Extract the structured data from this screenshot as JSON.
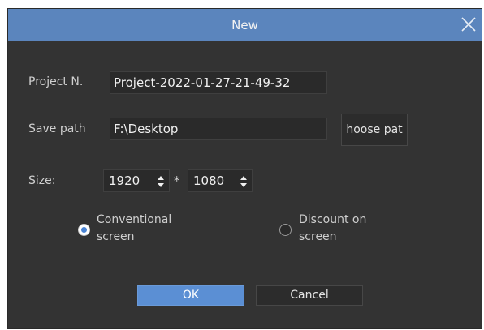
{
  "dialog": {
    "title": "New",
    "close_icon": "close-icon"
  },
  "form": {
    "project_name_label": "Project N.",
    "project_name_value": "Project-2022-01-27-21-49-32",
    "save_path_label": "Save path",
    "save_path_value": "F:\\Desktop",
    "choose_path_button": "hoose pat",
    "size_label": "Size:",
    "width_value": "1920",
    "separator": "*",
    "height_value": "1080"
  },
  "screen_mode": {
    "options": [
      {
        "label": "Conventional screen",
        "checked": true
      },
      {
        "label": "Discount on screen",
        "checked": false
      }
    ]
  },
  "buttons": {
    "ok": "OK",
    "cancel": "Cancel"
  },
  "colors": {
    "titlebar": "#5b85bd",
    "background": "#333333",
    "accent": "#4a84d4"
  }
}
